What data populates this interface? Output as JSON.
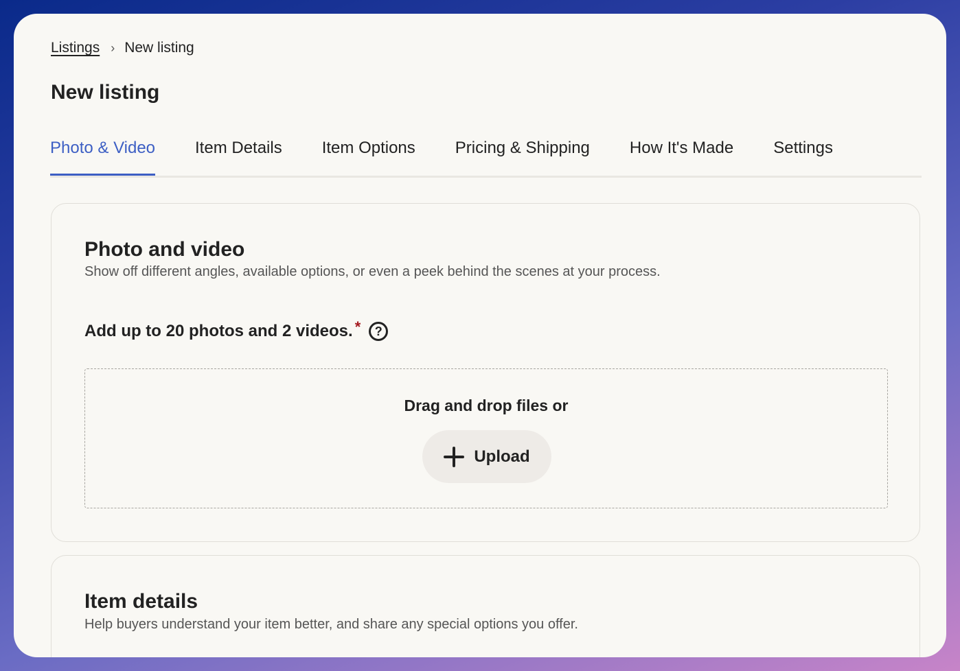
{
  "breadcrumb": {
    "parent": "Listings",
    "separator": "›",
    "current": "New listing"
  },
  "page": {
    "title": "New listing"
  },
  "tabs": [
    {
      "label": "Photo & Video",
      "active": true
    },
    {
      "label": "Item Details",
      "active": false
    },
    {
      "label": "Item Options",
      "active": false
    },
    {
      "label": "Pricing & Shipping",
      "active": false
    },
    {
      "label": "How It's Made",
      "active": false
    },
    {
      "label": "Settings",
      "active": false
    }
  ],
  "photo_section": {
    "title": "Photo and video",
    "description": "Show off different angles, available options, or even a peek behind the scenes at your process.",
    "add_label": "Add up to 20 photos and 2 videos.",
    "required_mark": "*",
    "help_icon": "question-circle-icon",
    "help_glyph": "?",
    "drop_text": "Drag and drop files or",
    "upload_label": "Upload",
    "upload_icon": "plus-icon"
  },
  "details_section": {
    "title": "Item details",
    "description": "Help buyers understand your item better, and share any special options you offer."
  },
  "colors": {
    "accent": "#3d5fc4",
    "required": "#a4191f",
    "card_background": "#f9f8f4",
    "upload_button": "#eeebe7"
  }
}
